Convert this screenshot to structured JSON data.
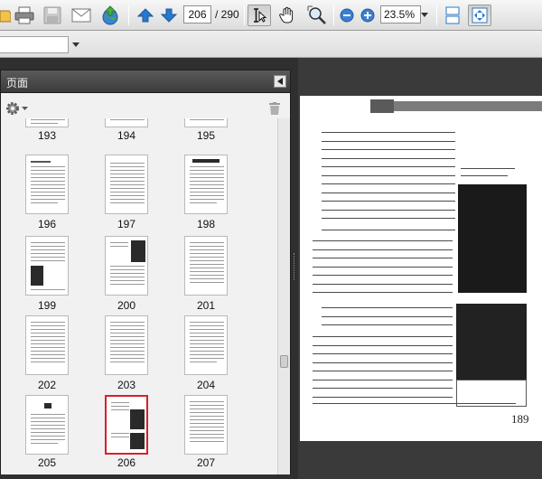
{
  "toolbar": {
    "page_current": "206",
    "page_total": "/ 290",
    "zoom": "23.5%"
  },
  "pages_panel": {
    "title": "页面"
  },
  "thumbnails": [
    {
      "label": "193"
    },
    {
      "label": "194"
    },
    {
      "label": "195"
    },
    {
      "label": "196"
    },
    {
      "label": "197"
    },
    {
      "label": "198"
    },
    {
      "label": "199"
    },
    {
      "label": "200"
    },
    {
      "label": "201"
    },
    {
      "label": "202"
    },
    {
      "label": "203"
    },
    {
      "label": "204"
    },
    {
      "label": "205"
    },
    {
      "label": "206"
    },
    {
      "label": "207"
    }
  ],
  "selected_page": "206",
  "document": {
    "page_number": "189"
  },
  "colors": {
    "selection": "#d8202a",
    "toolbar_arrow": "#2a78c8"
  }
}
